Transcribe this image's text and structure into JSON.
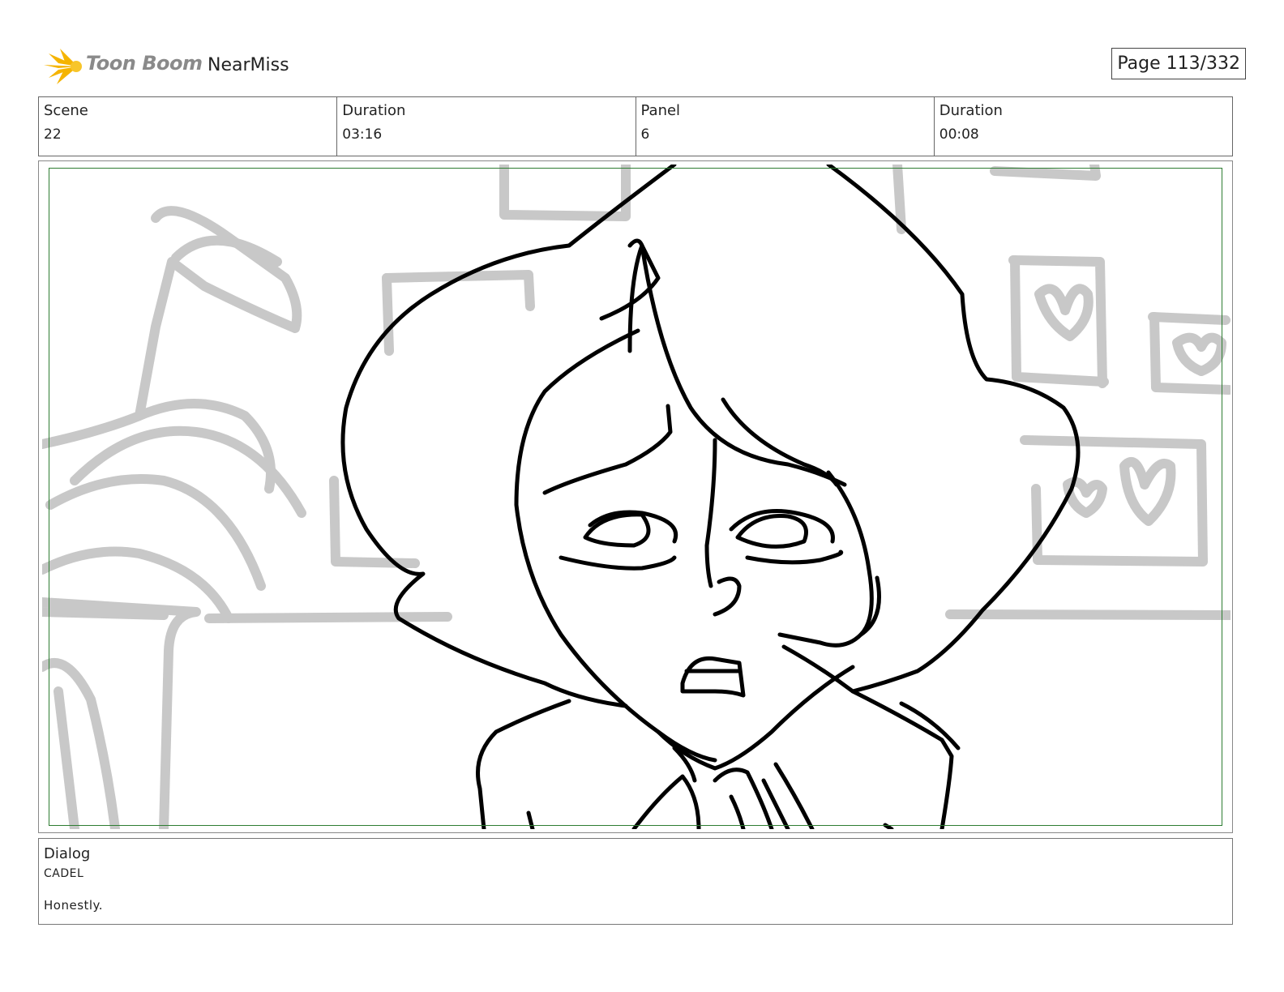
{
  "header": {
    "brand": "Toon Boom",
    "project_name": "NearMiss",
    "page_counter": "Page 113/332"
  },
  "info_bar": [
    {
      "label": "Scene",
      "value": "22"
    },
    {
      "label": "Duration",
      "value": "03:16"
    },
    {
      "label": "Panel",
      "value": "6"
    },
    {
      "label": "Duration",
      "value": "00:08"
    }
  ],
  "dialog": {
    "title": "Dialog",
    "speaker": "CADEL",
    "line": "Honestly."
  },
  "colors": {
    "safe_frame": "#2e7d32",
    "background_sketch": "#c8c8c8",
    "character_lines": "#000000",
    "logo_star": "#f5b400"
  }
}
